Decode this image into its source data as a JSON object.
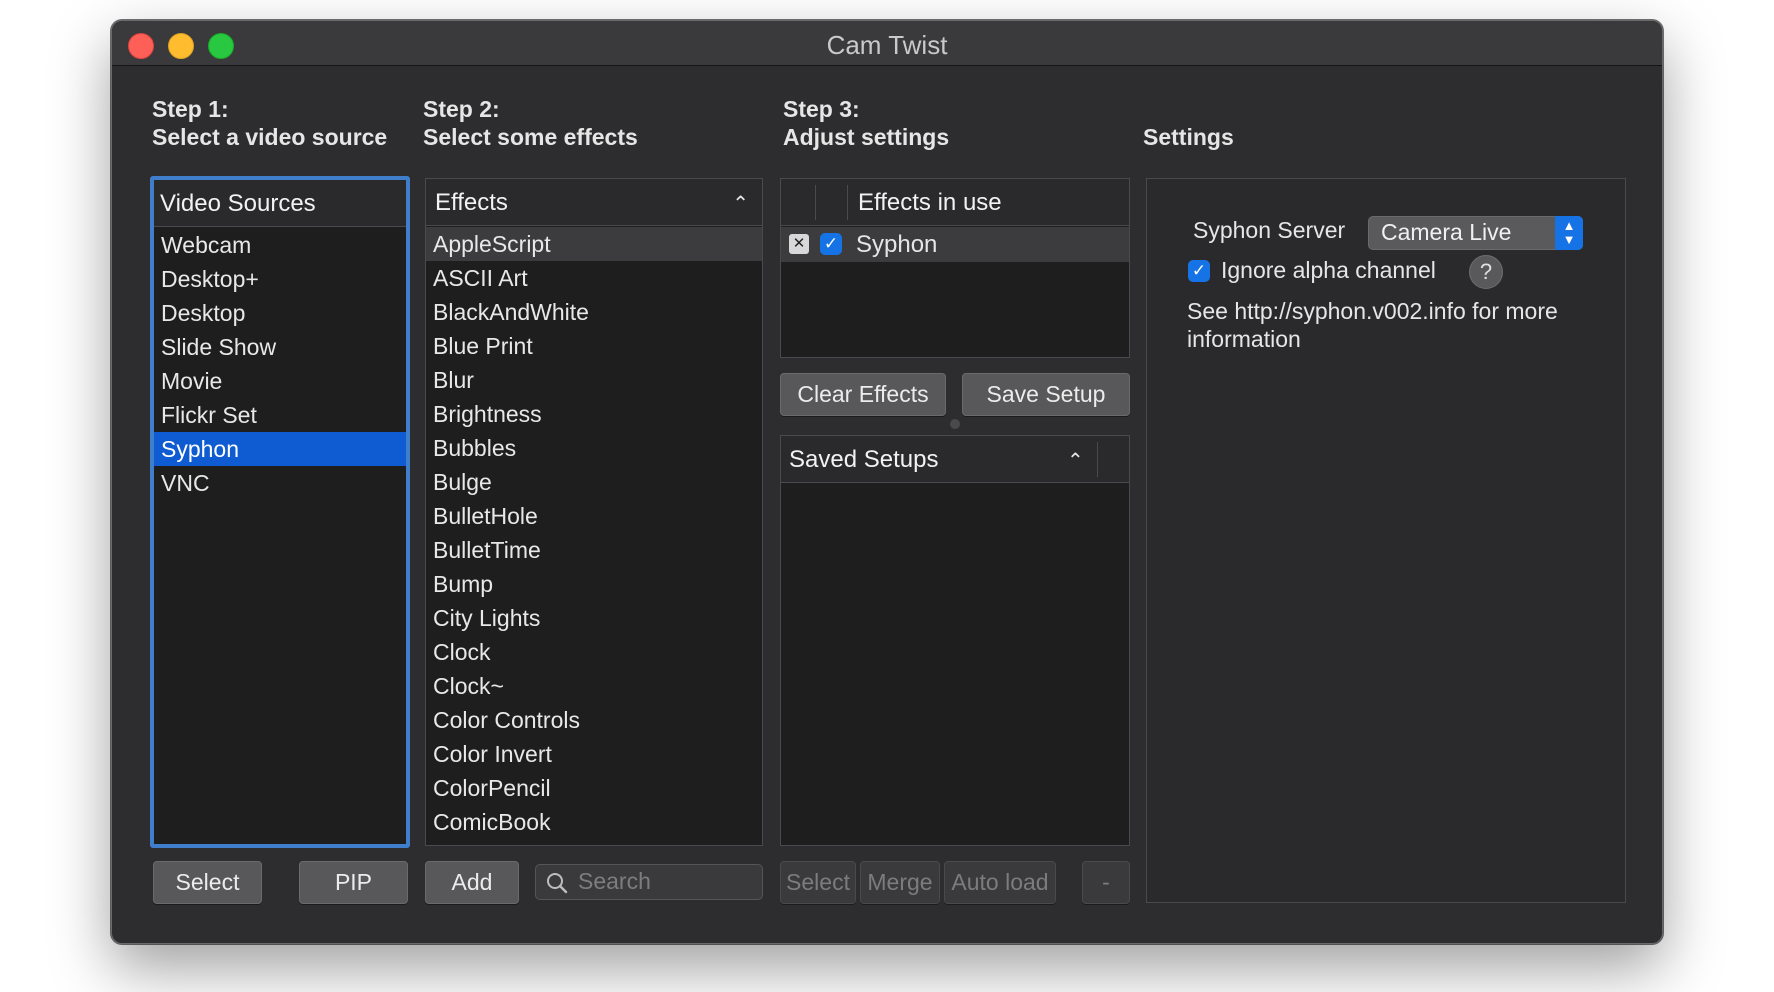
{
  "window": {
    "title": "Cam Twist"
  },
  "steps": {
    "step1": {
      "line1": "Step 1:",
      "line2": "Select a video source"
    },
    "step2": {
      "line1": "Step 2:",
      "line2": "Select some effects"
    },
    "step3": {
      "line1": "Step 3:",
      "line2": "Adjust settings"
    },
    "settings": {
      "title": "Settings"
    }
  },
  "video_sources": {
    "header": "Video Sources",
    "items": [
      "Webcam",
      "Desktop+",
      "Desktop",
      "Slide Show",
      "Movie",
      "Flickr Set",
      "Syphon",
      "VNC"
    ],
    "selected": "Syphon",
    "buttons": {
      "select": "Select",
      "pip": "PIP"
    }
  },
  "effects": {
    "header": "Effects",
    "items": [
      "AppleScript",
      "ASCII Art",
      "BlackAndWhite",
      "Blue Print",
      "Blur",
      "Brightness",
      "Bubbles",
      "Bulge",
      "BulletHole",
      "BulletTime",
      "Bump",
      "City Lights",
      "Clock",
      "Clock~",
      "Color Controls",
      "Color Invert",
      "ColorPencil",
      "ComicBook"
    ],
    "highlighted": "AppleScript",
    "add_label": "Add",
    "search_placeholder": "Search"
  },
  "effects_in_use": {
    "header": "Effects in use",
    "items": [
      {
        "name": "Syphon",
        "enabled": true
      }
    ],
    "clear_label": "Clear Effects",
    "save_label": "Save Setup"
  },
  "saved_setups": {
    "header": "Saved Setups",
    "buttons": {
      "select": "Select",
      "merge": "Merge",
      "auto_load": "Auto load",
      "remove": "-"
    }
  },
  "settings_panel": {
    "server_label": "Syphon Server",
    "server_value": "Camera Live",
    "ignore_alpha_label": "Ignore alpha channel",
    "ignore_alpha_checked": true,
    "help_label": "?",
    "info_text_line1": "See http://syphon.v002.info for more",
    "info_text_line2": "information"
  },
  "colors": {
    "selection": "#0f5bd2",
    "checkbox_accent": "#1673e6",
    "focus_ring": "#3f7ecb"
  }
}
